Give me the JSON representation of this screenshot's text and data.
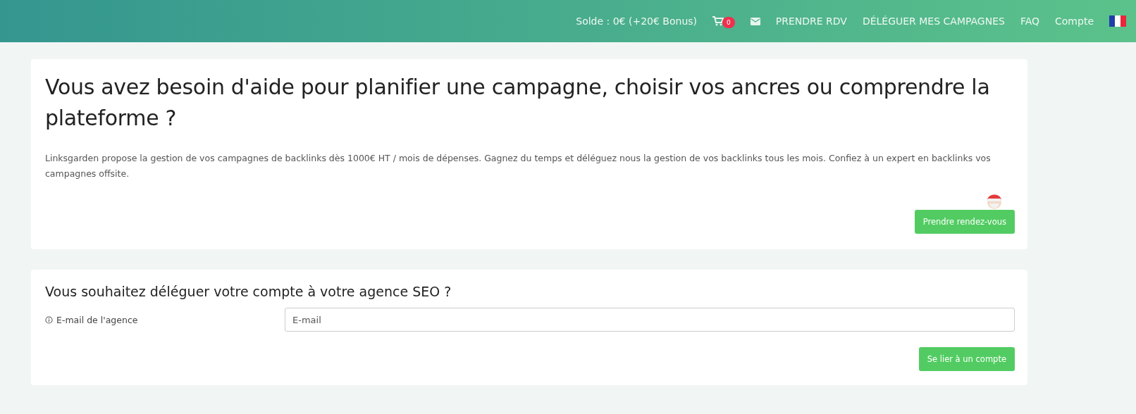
{
  "header": {
    "balance": "Solde : 0€ (+20€ Bonus)",
    "cart_count": "0",
    "links": [
      "PRENDRE RDV",
      "DÉLÉGUER MES CAMPAGNES",
      "FAQ",
      "Compte"
    ]
  },
  "help_card": {
    "title": "Vous avez besoin d'aide pour planifier une campagne, choisir vos ancres ou comprendre la plateforme ?",
    "text": "Linksgarden propose la gestion de vos campagnes de backlinks dès 1000€ HT / mois de dépenses. Gagnez du temps et déléguez nous la gestion de vos backlinks tous les mois. Confiez à un expert en backlinks vos campagnes offsite.",
    "button": "Prendre rendez-vous"
  },
  "agency_card": {
    "title": "Vous souhaitez déléguer votre compte à votre agence SEO ?",
    "field_label": "E-mail de l'agence",
    "placeholder": "E-mail",
    "button": "Se lier à un compte"
  }
}
